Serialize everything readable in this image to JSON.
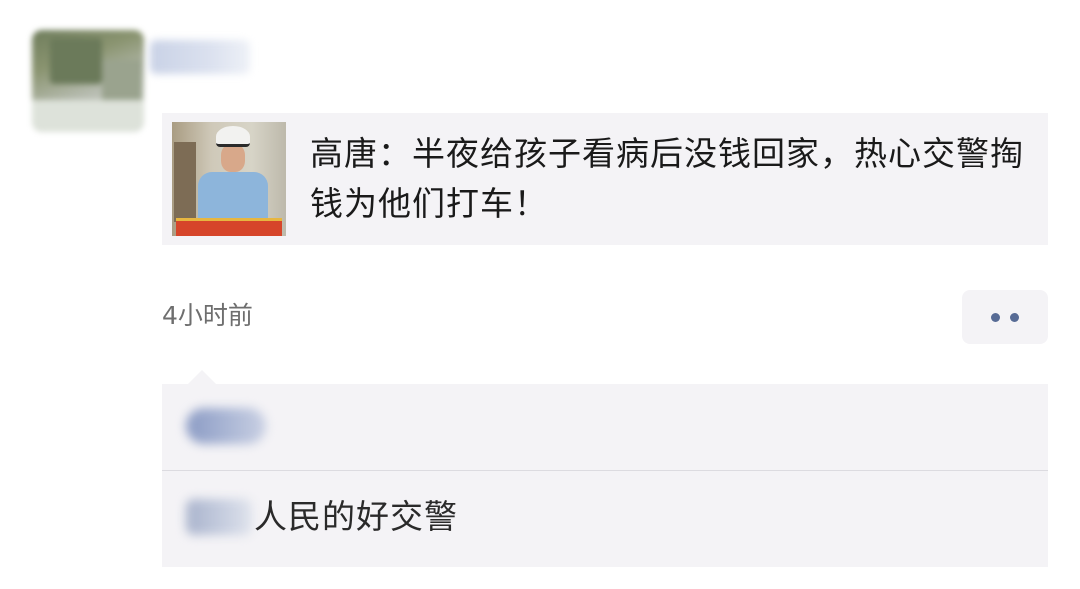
{
  "post": {
    "article_title": "高唐：半夜给孩子看病后没钱回家，热心交警掏钱为他们打车！",
    "timestamp": "4小时前"
  },
  "comments": [
    {
      "text": "人民的好交警"
    }
  ],
  "colors": {
    "link_blue": "#576b95",
    "card_bg": "#f4f3f6"
  },
  "icons": {
    "more": "two-dot-more-icon"
  }
}
